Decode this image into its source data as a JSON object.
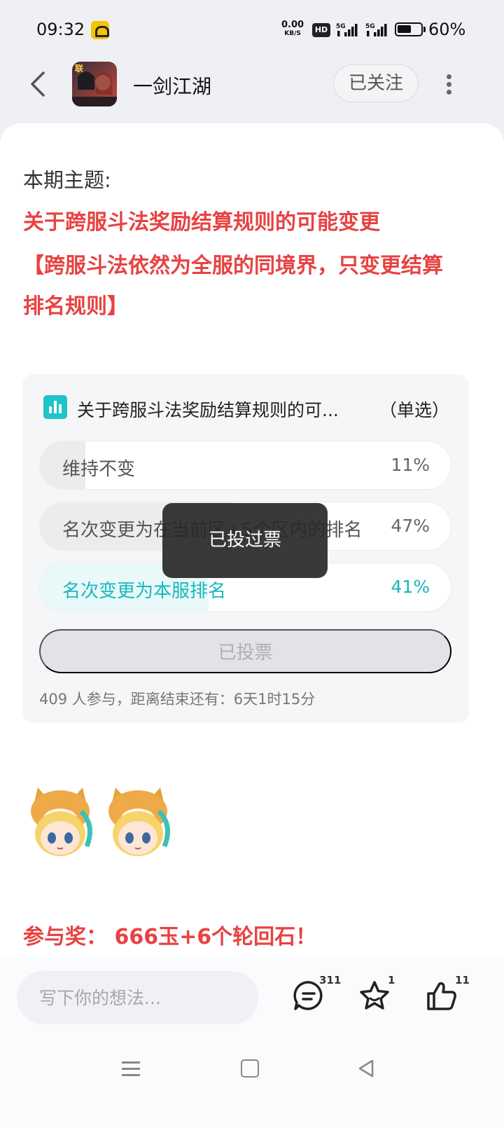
{
  "status_bar": {
    "time": "09:32",
    "net_speed_value": "0.00",
    "net_speed_unit": "KB/S",
    "hd_label": "HD",
    "network_1": "5G",
    "network_2": "5G",
    "battery_percent": "60%",
    "battery_level": 0.6
  },
  "header": {
    "back_icon": "chevron-left-icon",
    "title": "一剑江湖",
    "follow_label": "已关注",
    "more_icon": "more-vertical-icon"
  },
  "post": {
    "topic_label": "本期主题:",
    "topic_lines": [
      "关于跨服斗法奖励结算规则的可能变更",
      "【跨服斗法依然为全服的同境界，只变更结算",
      "排名规则】"
    ],
    "reward_text": "参与奖： 666玉+6个轮回石！"
  },
  "poll": {
    "icon": "bar-chart-icon",
    "title": "关于跨服斗法奖励结算规则的可...",
    "type": "（单选）",
    "options": [
      {
        "label": "维持不变",
        "percent_text": "11%",
        "percent": 11,
        "selected": false
      },
      {
        "label": "名次变更为在当前区+5个区内的排名",
        "percent_text": "47%",
        "percent": 47,
        "selected": false
      },
      {
        "label": "名次变更为本服排名",
        "percent_text": "41%",
        "percent": 41,
        "selected": true
      }
    ],
    "vote_button_label": "已投票",
    "footer": "409 人参与，距离结束还有：6天1时15分"
  },
  "toast": "已投过票",
  "bottom_bar": {
    "input_placeholder": "写下你的想法...",
    "comment_count": "311",
    "favorite_count": "1",
    "like_count": "11"
  },
  "colors": {
    "accent_red": "#e84242",
    "accent_teal": "#1ab7bc"
  }
}
